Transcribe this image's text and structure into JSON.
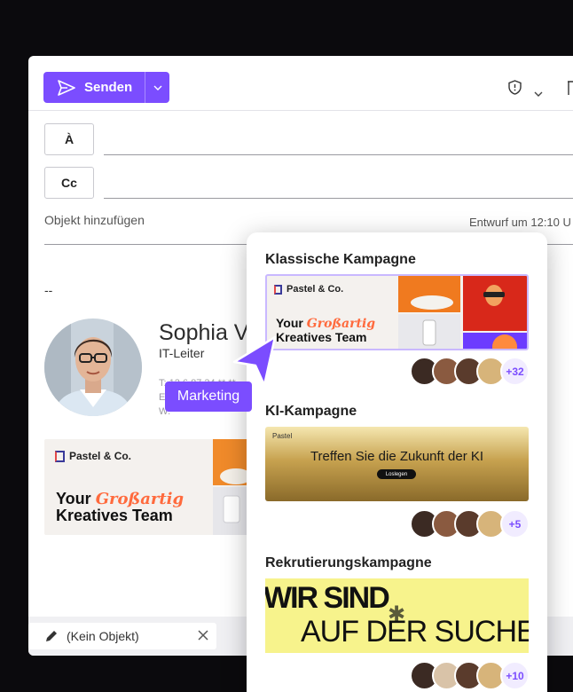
{
  "toolbar": {
    "send_label": "Senden"
  },
  "recipients": {
    "to_label": "À",
    "cc_label": "Cc"
  },
  "subject": {
    "placeholder": "Objekt hinzufügen",
    "draft_status": "Entwurf um 12:10 U"
  },
  "signature": {
    "separator": "--",
    "name": "Sophia Vo",
    "role": "IT-Leiter",
    "contact_lines": [
      "T: 12 6 87 34 ** **",
      "E:",
      "W:"
    ],
    "banner": {
      "brand": "Pastel & Co.",
      "line1": "Your",
      "highlight": "Großartig",
      "line2": "Kreatives Team"
    }
  },
  "bottom": {
    "draft_chip": "(Kein Objekt)"
  },
  "cursor_tag": "Marketing",
  "campaigns": {
    "classic": {
      "title": "Klassische Kampagne",
      "brand": "Pastel & Co.",
      "line1": "Your",
      "highlight": "Großartig",
      "line2": "Kreatives Team",
      "more": "+32"
    },
    "ai": {
      "title": "KI-Kampagne",
      "brand": "Pastel",
      "headline": "Treffen Sie die Zukunft der KI",
      "cta": "Loslegen",
      "more": "+5"
    },
    "recruit": {
      "title": "Rekrutierungskampagne",
      "line1": "WIR SIND",
      "line2": "AUF DER SUCHE",
      "more": "+10"
    }
  },
  "colors": {
    "accent": "#7b4dff",
    "highlight": "#ff6a3d",
    "recruit_bg": "#f7f38c"
  }
}
